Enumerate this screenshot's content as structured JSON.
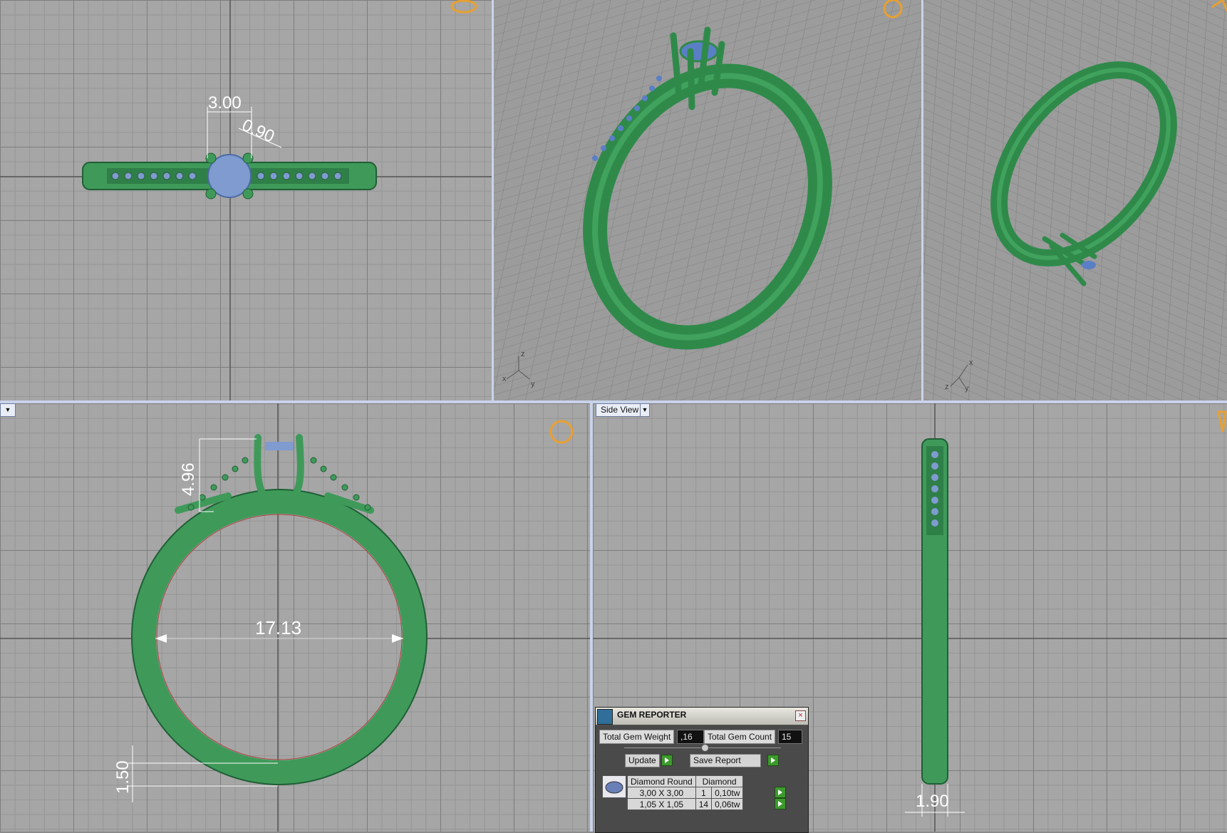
{
  "colors": {
    "metal": "#3f9a5a",
    "metal_dark": "#1f5f35",
    "gem": "#8aa4d8",
    "dimension": "#ffffff",
    "gizmo": "#e8a030"
  },
  "viewports": {
    "top": {
      "dims": {
        "width": "3.00",
        "prong": "0.90"
      }
    },
    "perspective1": {
      "axis": {
        "x": "x",
        "y": "y",
        "z": "z"
      }
    },
    "perspective2": {
      "axis": {
        "x": "x",
        "y": "y",
        "z": "z"
      }
    },
    "front": {
      "dims": {
        "diameter": "17.13",
        "height": "4.96",
        "thickness": "1.50"
      }
    },
    "side": {
      "label": "Side View",
      "dims": {
        "width": "1.90"
      }
    }
  },
  "gem_reporter": {
    "title": "GEM REPORTER",
    "total_weight_label": "Total Gem Weight",
    "total_weight_value": ",16",
    "total_count_label": "Total Gem Count",
    "total_count_value": "15",
    "update_label": "Update",
    "save_label": "Save Report",
    "table": {
      "headers": [
        "Diamond Round",
        "Diamond"
      ],
      "rows": [
        {
          "size": "3,00 X 3,00",
          "count": "1",
          "weight": "0,10tw"
        },
        {
          "size": "1,05 X 1,05",
          "count": "14",
          "weight": "0,06tw"
        }
      ]
    }
  }
}
